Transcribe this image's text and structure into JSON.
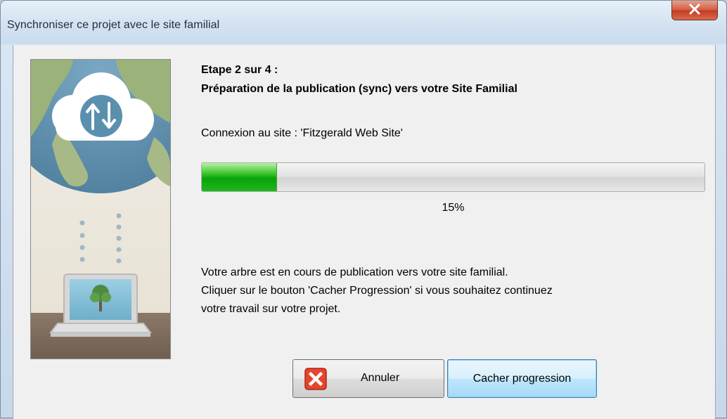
{
  "window": {
    "title": "Synchroniser ce projet avec le site familial",
    "close_icon": "close-icon"
  },
  "illustration": {
    "description_icon": "sync-cloud-illustration",
    "cloud_icon": "sync-arrows-icon",
    "laptop_icon": "laptop-tree-icon"
  },
  "step": {
    "title": "Etape 2 sur 4 :",
    "subtitle": "Préparation de la publication (sync) vers votre Site Familial"
  },
  "connection": {
    "text": "Connexion au site : 'Fitzgerald Web Site'"
  },
  "progress": {
    "value": 0.15,
    "label": "15%",
    "fill_color": "#07a40c"
  },
  "message": {
    "lines": [
      "Votre arbre est en cours de publication vers votre site familial.",
      "Cliquer sur le bouton 'Cacher Progression' si vous souhaitez continuez",
      "votre travail sur votre projet."
    ]
  },
  "buttons": {
    "cancel_label": "Annuler",
    "cancel_icon": "cancel-x-icon",
    "hide_label": "Cacher progression"
  },
  "colors": {
    "title_bar": "#d6e4f2",
    "dialog_bg": "#f0f0f0",
    "close_red": "#c23b22",
    "focused_button": "#3c7fb1"
  }
}
